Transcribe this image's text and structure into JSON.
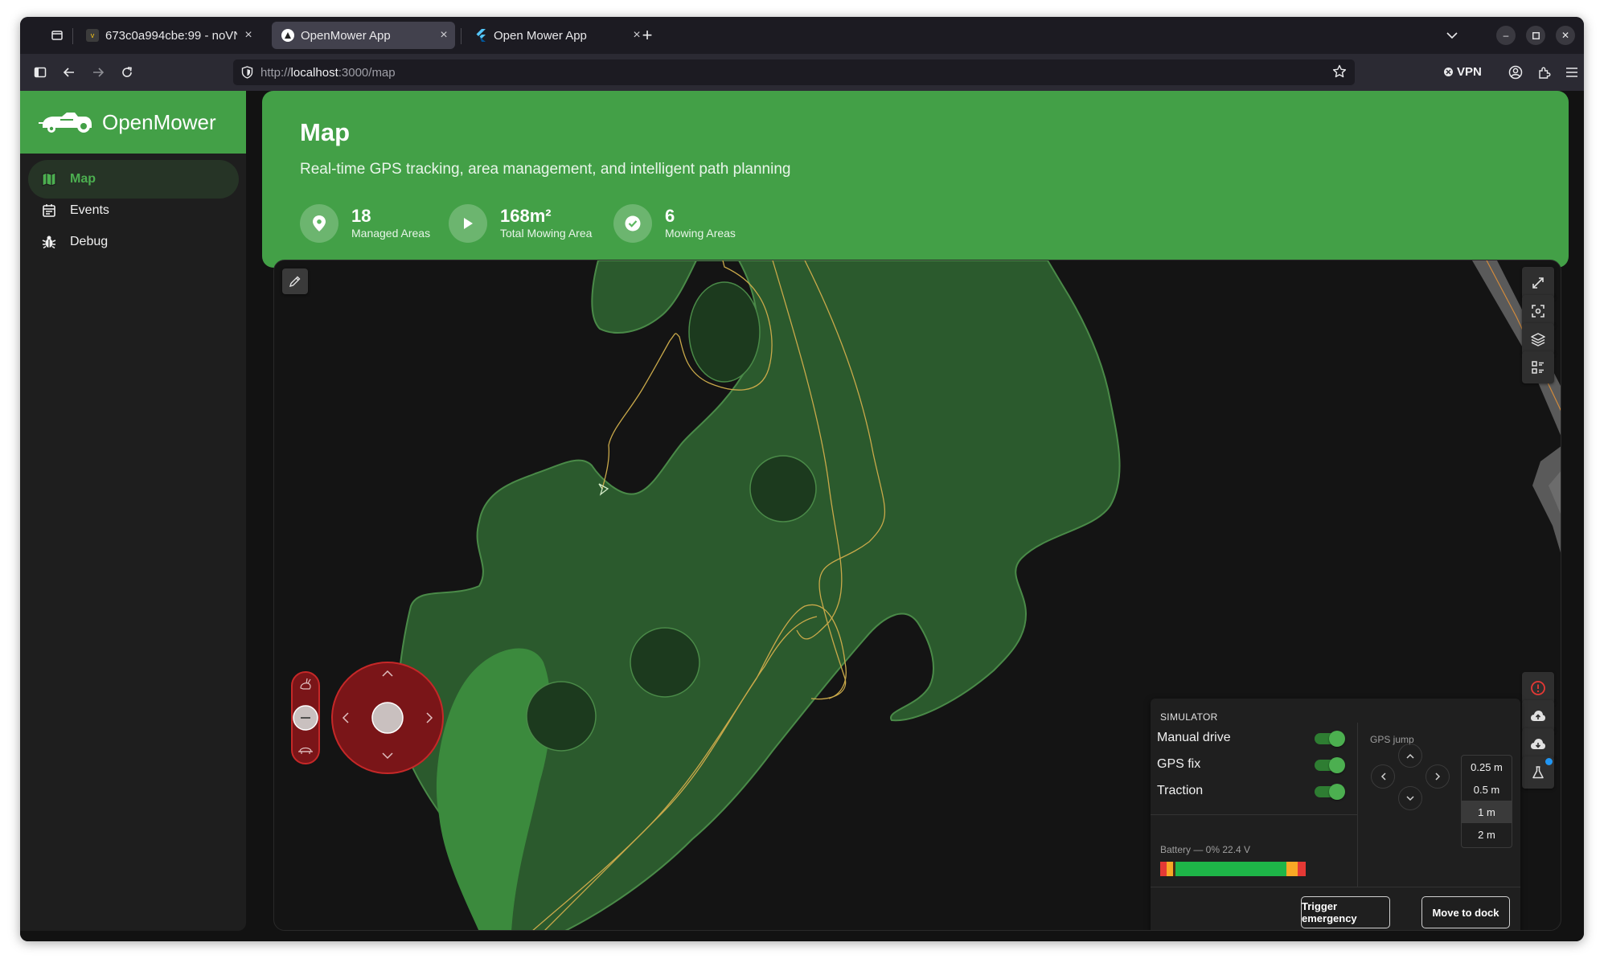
{
  "browser": {
    "tabs": [
      {
        "title": "673c0a994cbe:99 - noVNC",
        "favicon": "novnc-favicon",
        "active": false
      },
      {
        "title": "OpenMower App",
        "favicon": "openmower-favicon",
        "active": true
      },
      {
        "title": "Open Mower App",
        "favicon": "flutter-favicon",
        "active": false
      }
    ],
    "url_scheme": "http://",
    "url_host": "localhost",
    "url_rest": ":3000/map",
    "vpn_label": "VPN"
  },
  "app": {
    "brand_name": "OpenMower",
    "nav": [
      {
        "label": "Map",
        "icon": "map-icon",
        "active": true
      },
      {
        "label": "Events",
        "icon": "calendar-icon",
        "active": false
      },
      {
        "label": "Debug",
        "icon": "bug-icon",
        "active": false
      }
    ]
  },
  "header": {
    "title": "Map",
    "subtitle": "Real-time GPS tracking, area management, and intelligent path planning",
    "stats": [
      {
        "value": "18",
        "label": "Managed Areas",
        "icon": "location-pin-icon"
      },
      {
        "value": "168m²",
        "label": "Total Mowing Area",
        "icon": "play-icon"
      },
      {
        "value": "6",
        "label": "Mowing Areas",
        "icon": "check-circle-icon"
      }
    ]
  },
  "simulator": {
    "title": "SIMULATOR",
    "toggles": [
      {
        "label": "Manual drive",
        "on": true
      },
      {
        "label": "GPS fix",
        "on": true
      },
      {
        "label": "Traction",
        "on": true
      }
    ],
    "gps_jump_label": "GPS jump",
    "jump_options": [
      "0.25 m",
      "0.5 m",
      "1 m",
      "2 m"
    ],
    "jump_selected": "1 m",
    "battery_label": "Battery — 0% 22.4 V",
    "buttons": {
      "emergency": "Trigger emergency",
      "dock": "Move to dock"
    }
  },
  "colors": {
    "accent": "#43a047",
    "area_fill": "#2b5a2d",
    "area_edge": "#4a8a48",
    "obstacle": "#1c3a1e",
    "path": "#c9a94a",
    "joystick": "#7a1518"
  }
}
